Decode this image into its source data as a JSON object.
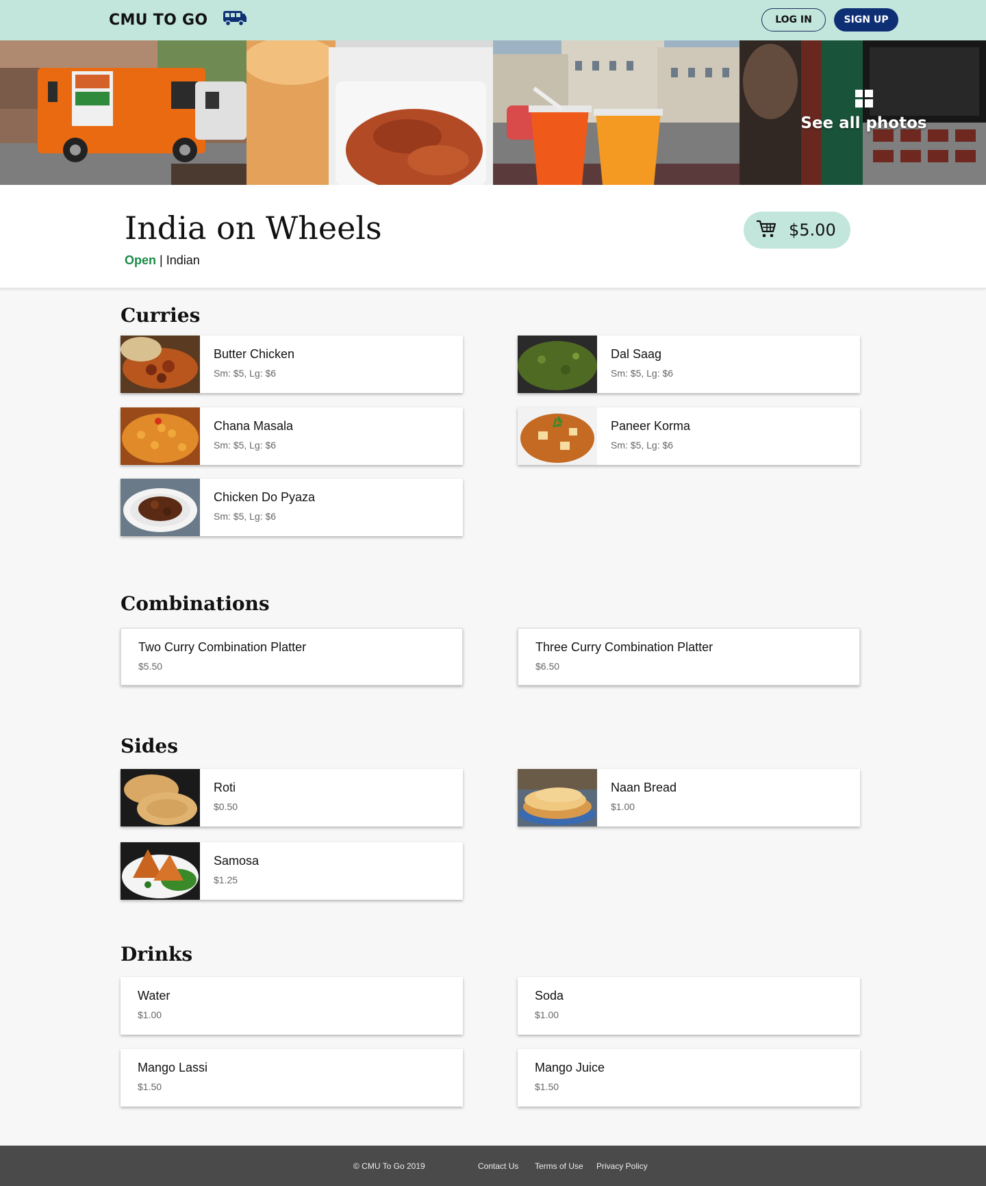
{
  "nav": {
    "brand": "CMU TO GO",
    "login_label": "LOG IN",
    "signup_label": "SIGN UP"
  },
  "gallery": {
    "see_all_label": "See all photos"
  },
  "truck": {
    "name": "India on Wheels",
    "status": "Open",
    "separator": "|",
    "cuisine": "Indian",
    "cart_total": "$5.00"
  },
  "sections": {
    "curries": {
      "title": "Curries",
      "items": [
        {
          "name": "Butter Chicken",
          "price": "Sm: $5, Lg: $6"
        },
        {
          "name": "Dal Saag",
          "price": "Sm: $5, Lg: $6"
        },
        {
          "name": "Chana Masala",
          "price": "Sm: $5, Lg: $6"
        },
        {
          "name": "Paneer Korma",
          "price": "Sm: $5, Lg: $6"
        },
        {
          "name": "Chicken Do Pyaza",
          "price": "Sm: $5, Lg: $6"
        }
      ]
    },
    "combinations": {
      "title": "Combinations",
      "items": [
        {
          "name": "Two Curry Combination Platter",
          "price": "$5.50"
        },
        {
          "name": "Three Curry Combination Platter",
          "price": "$6.50"
        }
      ]
    },
    "sides": {
      "title": "Sides",
      "items": [
        {
          "name": "Roti",
          "price": "$0.50"
        },
        {
          "name": "Naan Bread",
          "price": "$1.00"
        },
        {
          "name": "Samosa",
          "price": "$1.25"
        }
      ]
    },
    "drinks": {
      "title": "Drinks",
      "items": [
        {
          "name": "Water",
          "price": "$1.00"
        },
        {
          "name": "Soda",
          "price": "$1.00"
        },
        {
          "name": "Mango Lassi",
          "price": "$1.50"
        },
        {
          "name": "Mango Juice",
          "price": "$1.50"
        }
      ]
    }
  },
  "footer": {
    "copyright": "© CMU To Go 2019",
    "contact": "Contact Us",
    "terms": "Terms of Use",
    "privacy": "Privacy Policy"
  },
  "colors": {
    "nav_bg": "#c2e5dc",
    "signup_bg": "#0e2f74",
    "open_green": "#1a8a46",
    "footer_bg": "#4a4a4a"
  },
  "icons": [
    "truck-icon",
    "grid-icon",
    "cart-icon"
  ]
}
